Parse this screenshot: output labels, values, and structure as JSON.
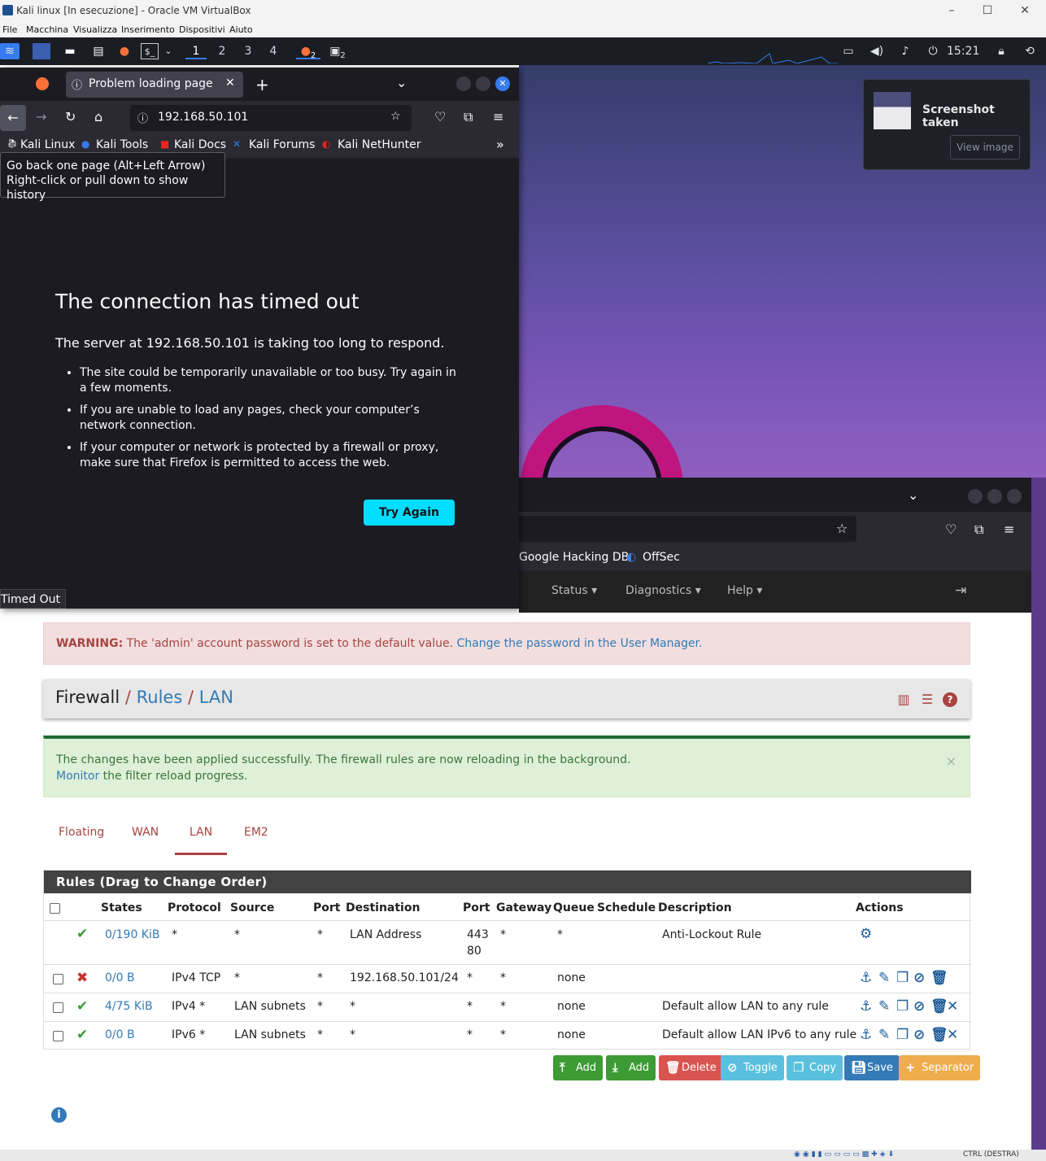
{
  "host": {
    "title": "Kali linux [In esecuzione] - Oracle VM VirtualBox",
    "menu": [
      "File",
      "Macchina",
      "Visualizza",
      "Inserimento",
      "Dispositivi",
      "Aiuto"
    ],
    "hostkey": "CTRL (DESTRA)"
  },
  "panel": {
    "workspaces": [
      "1",
      "2",
      "3",
      "4"
    ],
    "badge_firefox": "2",
    "badge_terminal": "2",
    "clock": "15:21"
  },
  "notification": {
    "title": "Screenshot taken",
    "button": "View image"
  },
  "browser_front": {
    "tab_title": "Problem loading page",
    "url": "192.168.50.101",
    "bookmarks": [
      "Kali Linux",
      "Kali Tools",
      "Kali Docs",
      "Kali Forums",
      "Kali NetHunter"
    ],
    "tooltip_line1": "Go back one page (Alt+Left Arrow)",
    "tooltip_line2": "Right-click or pull down to show history",
    "error_title": "The connection has timed out",
    "error_lead": "The server at 192.168.50.101 is taking too long to respond.",
    "bullets": [
      "The site could be temporarily unavailable or too busy. Try again in a few moments.",
      "If you are unable to load any pages, check your computer’s network connection.",
      "If your computer or network is protected by a firewall or proxy, make sure that Firefox is permitted to access the web."
    ],
    "try_again": "Try Again",
    "status": "Timed Out"
  },
  "browser_back": {
    "bookmarks": [
      "Google Hacking DB",
      "OffSec"
    ],
    "nav": [
      "Status",
      "Diagnostics",
      "Help"
    ]
  },
  "pfsense": {
    "warning_bold": "WARNING:",
    "warning_text": "The 'admin' account password is set to the default value.",
    "warning_link": "Change the password in the User Manager.",
    "crumb": {
      "root": "Firewall",
      "mid": "Rules",
      "leaf": "LAN"
    },
    "success_line1": "The changes have been applied successfully. The firewall rules are now reloading in the background.",
    "success_link": "Monitor",
    "success_tail": "the filter reload progress.",
    "tabs": [
      "Floating",
      "WAN",
      "LAN",
      "EM2"
    ],
    "active_tab": "LAN",
    "table_title": "Rules (Drag to Change Order)",
    "columns": [
      "States",
      "Protocol",
      "Source",
      "Port",
      "Destination",
      "Port",
      "Gateway",
      "Queue",
      "Schedule",
      "Description",
      "Actions"
    ],
    "rows": [
      {
        "status": "pass",
        "states": "0/190 KiB",
        "protocol": "*",
        "source": "*",
        "sport": "*",
        "destination": "LAN Address",
        "dport_1": "443",
        "dport_2": "80",
        "gateway": "*",
        "queue": "*",
        "schedule": "",
        "description": "Anti-Lockout Rule"
      },
      {
        "status": "block",
        "states": "0/0 B",
        "protocol": "IPv4 TCP",
        "source": "*",
        "sport": "*",
        "destination": "192.168.50.101/24",
        "dport": "*",
        "gateway": "*",
        "queue": "none",
        "schedule": "",
        "description": ""
      },
      {
        "status": "pass",
        "states": "4/75 KiB",
        "protocol": "IPv4 *",
        "source": "LAN subnets",
        "sport": "*",
        "destination": "*",
        "dport": "*",
        "gateway": "*",
        "queue": "none",
        "schedule": "",
        "description": "Default allow LAN to any rule"
      },
      {
        "status": "pass",
        "states": "0/0 B",
        "protocol": "IPv6 *",
        "source": "LAN subnets",
        "sport": "*",
        "destination": "*",
        "dport": "*",
        "gateway": "*",
        "queue": "none",
        "schedule": "",
        "description": "Default allow LAN IPv6 to any rule"
      }
    ],
    "buttons": {
      "add_top": "Add",
      "add_bottom": "Add",
      "delete": "Delete",
      "toggle": "Toggle",
      "copy": "Copy",
      "save": "Save",
      "separator": "Separator"
    }
  }
}
